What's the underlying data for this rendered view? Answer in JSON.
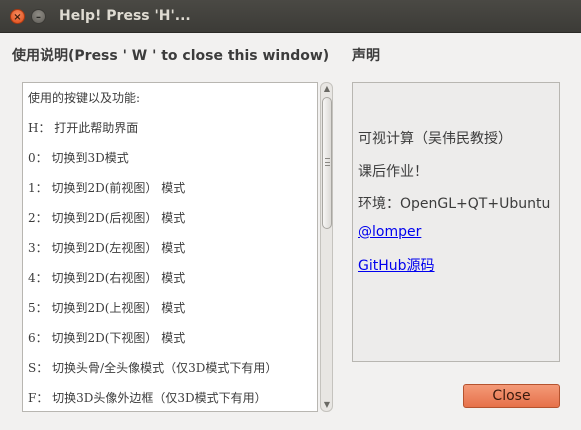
{
  "window": {
    "title": "Help! Press 'H'...",
    "close_glyph": "×",
    "min_glyph": "–"
  },
  "left": {
    "title": "使用说明(Press ' W ' to close this window)",
    "lines": [
      "使用的按键以及功能:",
      "H： 打开此帮助界面",
      "0： 切换到3D模式",
      "1： 切换到2D(前视图） 模式",
      "2： 切换到2D(后视图） 模式",
      "3： 切换到2D(左视图） 模式",
      "4： 切换到2D(右视图） 模式",
      "5： 切换到2D(上视图） 模式",
      "6： 切换到2D(下视图） 模式",
      "S： 切换头骨/全头像模式（仅3D模式下有用）",
      "F： 切换3D头像外边框（仅3D模式下有用）"
    ]
  },
  "right": {
    "title": "声明",
    "lines": {
      "course": "可视计算（吴伟民教授）",
      "homework": "课后作业！",
      "env": "环境：OpenGL+QT+Ubuntu",
      "author_link": "@lomper",
      "source_link": "GitHub源码"
    }
  },
  "buttons": {
    "close_label": "Close"
  },
  "icons": {
    "scroll_up": "▲",
    "scroll_down": "▼"
  }
}
